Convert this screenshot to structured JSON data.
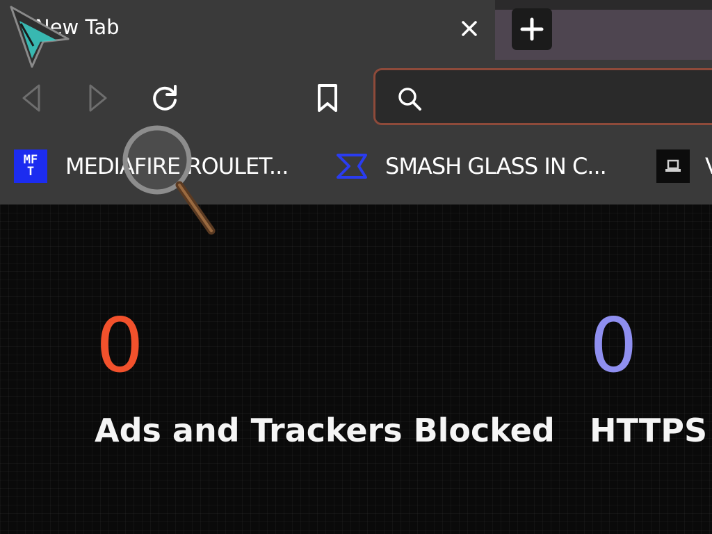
{
  "tab": {
    "title": "New Tab",
    "close_icon": "close-icon",
    "new_tab_icon": "plus-icon"
  },
  "toolbar": {
    "back_icon": "back-arrow-icon",
    "forward_icon": "forward-arrow-icon",
    "reload_icon": "reload-icon",
    "bookmark_icon": "bookmark-icon",
    "address": {
      "value": "",
      "search_icon": "search-icon"
    }
  },
  "bookmarks": [
    {
      "label": "MEDIAFIRE ROULET...",
      "icon": "mft-icon",
      "icon_text": [
        "MF",
        "T"
      ]
    },
    {
      "label": "SMASH GLASS IN C...",
      "icon": "smash-glass-icon"
    },
    {
      "label": "V",
      "icon": "laptop-icon"
    }
  ],
  "stats": {
    "ads": {
      "count": "0",
      "label": "Ads and Trackers Blocked"
    },
    "https": {
      "count": "0",
      "label": "HTTPS U"
    }
  },
  "colors": {
    "ads_accent": "#f2512c",
    "https_accent": "#8f8ff0",
    "address_border": "#8e4a3a",
    "mft_blue": "#1c2cf0",
    "smash_blue": "#2a3cf0"
  }
}
